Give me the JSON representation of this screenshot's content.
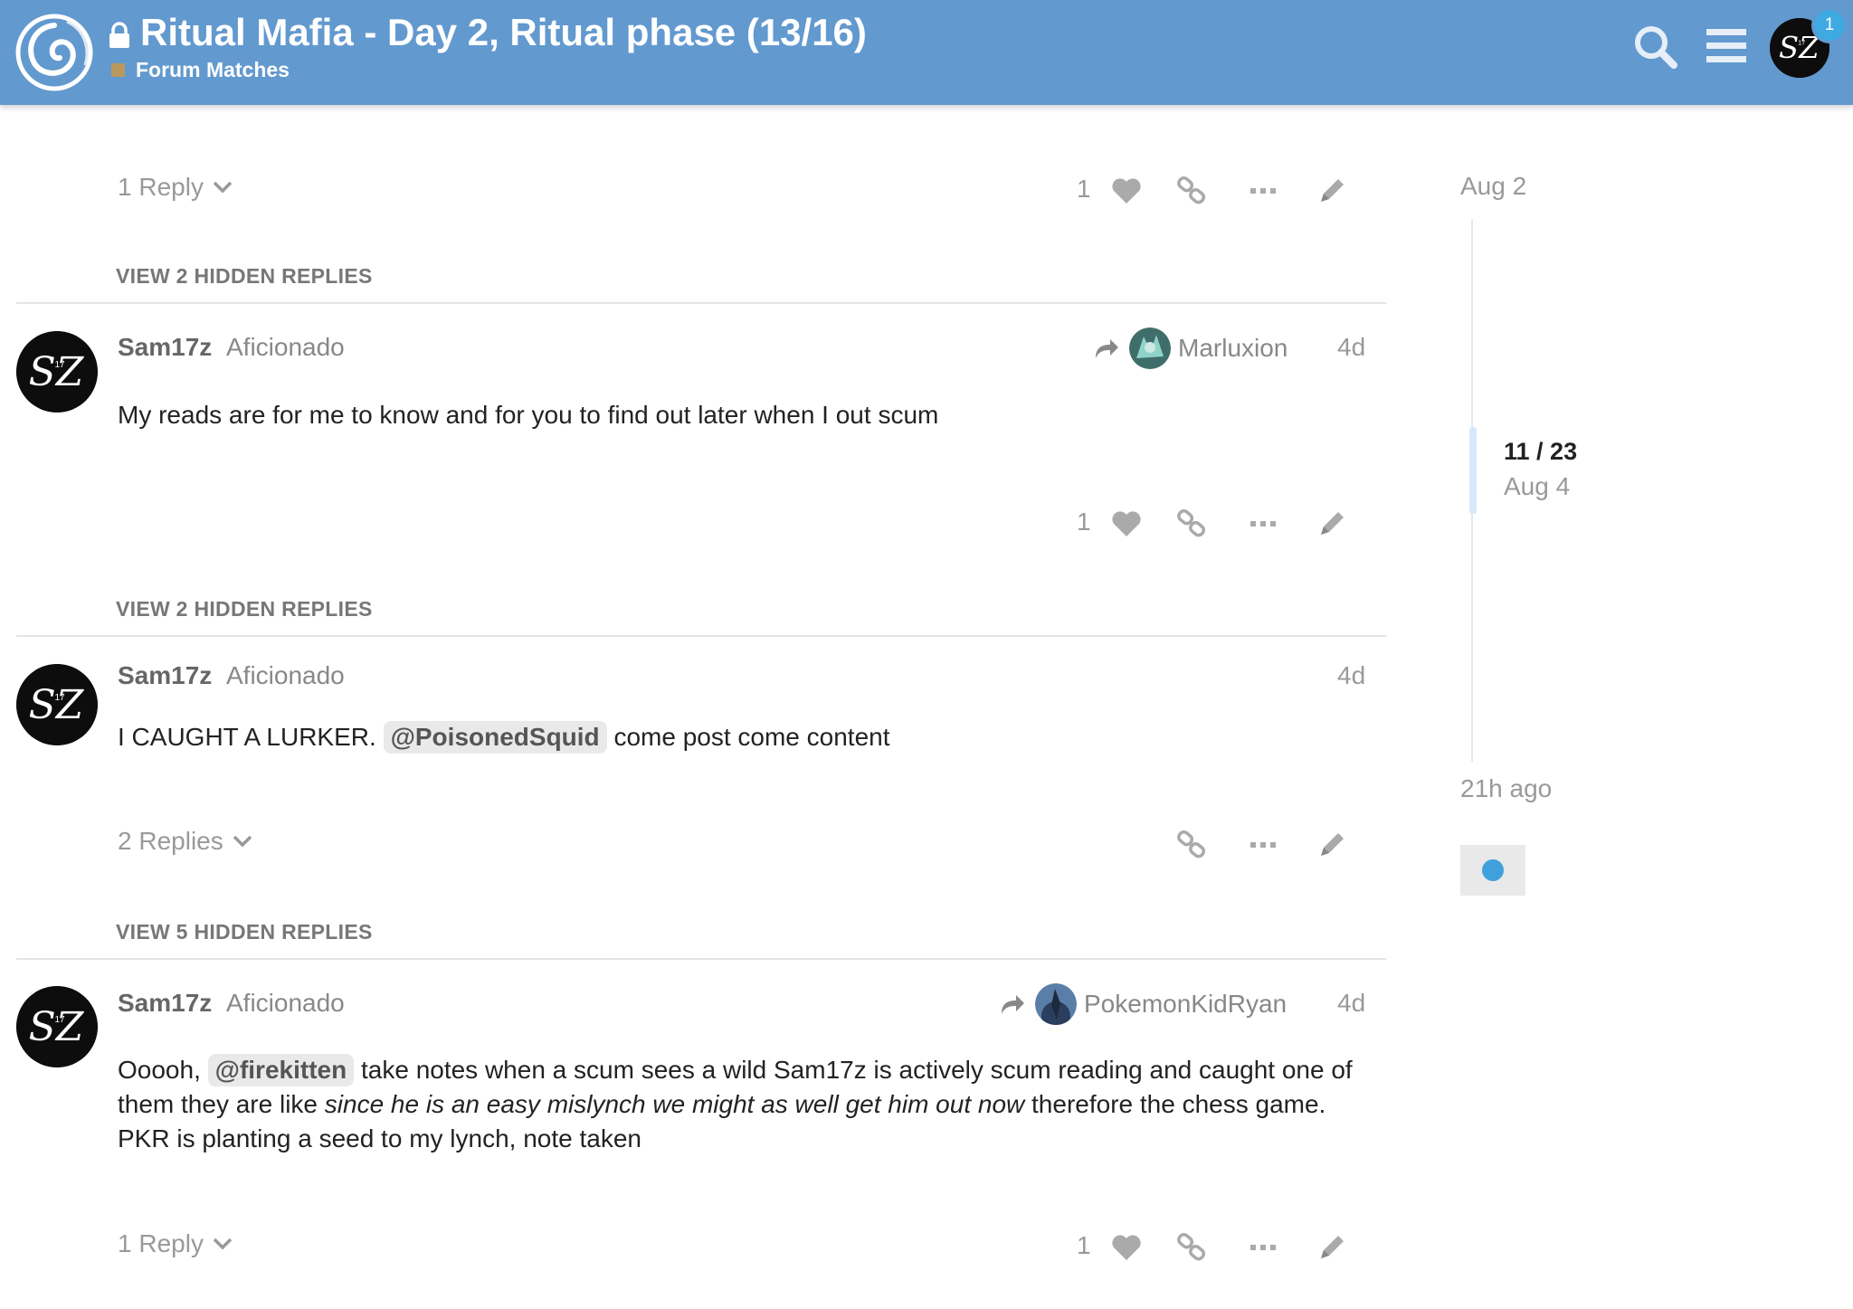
{
  "header": {
    "title": "Ritual Mafia - Day 2, Ritual phase (13/16)",
    "category": "Forum Matches",
    "notifications": "1",
    "colors": {
      "bar": "#6299cf",
      "category_swatch": "#b9985f",
      "badge": "#3fa9e1"
    }
  },
  "top_actions": {
    "replies": "1 Reply",
    "likes": "1"
  },
  "posts": [
    {
      "hidden_replies": "VIEW 2 HIDDEN REPLIES",
      "username": "Sam17z",
      "user_title": "Aficionado",
      "reply_to": "Marluxion",
      "date": "4d",
      "text": "My reads are for me to know and for you to find out later when I out scum",
      "likes": "1"
    },
    {
      "hidden_replies": "VIEW 2 HIDDEN REPLIES",
      "username": "Sam17z",
      "user_title": "Aficionado",
      "date": "4d",
      "text_before": "I CAUGHT A LURKER.",
      "mention": "@PoisonedSquid",
      "text_after": "come post come content",
      "replies": "2 Replies"
    },
    {
      "hidden_replies": "VIEW 5 HIDDEN REPLIES",
      "username": "Sam17z",
      "user_title": "Aficionado",
      "reply_to": "PokemonKidRyan",
      "date": "4d",
      "text_before": "Ooooh,",
      "mention": "@firekitten",
      "text_middle": "take notes when a scum sees a wild Sam17z is actively scum reading and caught one of them they are like",
      "text_italic": "since he is an easy mislynch we might as well get him out now",
      "text_after": "therefore the chess game. PKR is planting a seed to my lynch, note taken",
      "replies": "1 Reply",
      "likes": "1"
    }
  ],
  "timeline": {
    "start_date": "Aug 2",
    "position": "11 / 23",
    "position_date": "Aug 4",
    "end_label": "21h ago"
  },
  "avatar_text": {
    "main": "SZ",
    "sub": "17"
  }
}
